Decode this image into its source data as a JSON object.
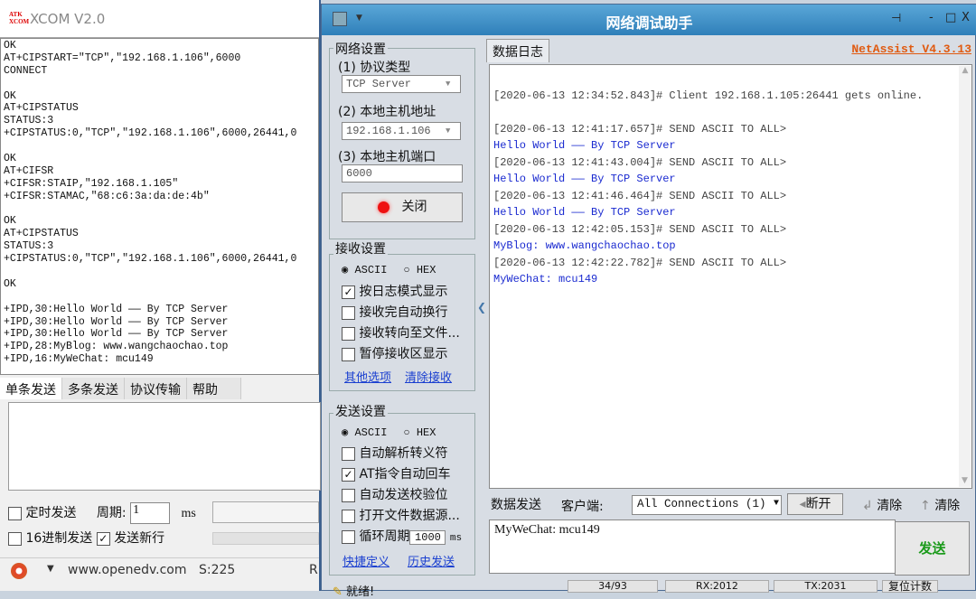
{
  "xcom": {
    "title": "XCOM V2.0",
    "logo_text": "ATK XCOM",
    "receive_lines": [
      "OK",
      "AT+CIPSTART=\"TCP\",\"192.168.1.106\",6000",
      "CONNECT",
      "",
      "OK",
      "AT+CIPSTATUS",
      "STATUS:3",
      "+CIPSTATUS:0,\"TCP\",\"192.168.1.106\",6000,26441,0",
      "",
      "OK",
      "AT+CIFSR",
      "+CIFSR:STAIP,\"192.168.1.105\"",
      "+CIFSR:STAMAC,\"68:c6:3a:da:de:4b\"",
      "",
      "OK",
      "AT+CIPSTATUS",
      "STATUS:3",
      "+CIPSTATUS:0,\"TCP\",\"192.168.1.106\",6000,26441,0",
      "",
      "OK",
      "",
      "+IPD,30:Hello World —— By TCP Server",
      "+IPD,30:Hello World —— By TCP Server",
      "+IPD,30:Hello World —— By TCP Server",
      "+IPD,28:MyBlog: www.wangchaochao.top",
      "+IPD,16:MyWeChat: mcu149"
    ],
    "tabs": [
      "单条发送",
      "多条发送",
      "协议传输",
      "帮助"
    ],
    "timed_send": "定时发送",
    "period_label": "周期:",
    "period_value": "1",
    "period_unit": "ms",
    "hex_send": "16进制发送",
    "send_newline": "发送新行",
    "status_url": "www.openedv.com",
    "status_s": "S:225",
    "status_r": "R"
  },
  "netassist": {
    "title": "网络调试助手",
    "version": "NetAssist V4.3.13",
    "net_settings": "网络设置",
    "protocol_label": "(1) 协议类型",
    "protocol_value": "TCP Server",
    "host_label": "(2) 本地主机地址",
    "host_value": "192.168.1.106",
    "port_label": "(3) 本地主机端口",
    "port_value": "6000",
    "close_button": "关闭",
    "recv_settings": "接收设置",
    "ascii": "ASCII",
    "hex": "HEX",
    "recv_opts": [
      {
        "label": "按日志模式显示",
        "checked": true
      },
      {
        "label": "接收完自动换行",
        "checked": false
      },
      {
        "label": "接收转向至文件...",
        "checked": false
      },
      {
        "label": "暂停接收区显示",
        "checked": false
      }
    ],
    "more_options": "其他选项",
    "clear_recv": "清除接收",
    "send_settings": "发送设置",
    "send_opts": [
      {
        "label": "自动解析转义符",
        "checked": false
      },
      {
        "label": "AT指令自动回车",
        "checked": true
      },
      {
        "label": "自动发送校验位",
        "checked": false
      },
      {
        "label": "打开文件数据源...",
        "checked": false
      }
    ],
    "loop_label": "循环周期",
    "loop_value": "1000",
    "loop_unit": "ms",
    "shortcut": "快捷定义",
    "history": "历史发送",
    "log_tab": "数据日志",
    "log": [
      {
        "t": "",
        "c": "sys"
      },
      {
        "t": "[2020-06-13 12:34:52.843]# Client 192.168.1.105:26441 gets online.",
        "c": "sys"
      },
      {
        "t": "",
        "c": "sys"
      },
      {
        "t": "[2020-06-13 12:41:17.657]# SEND ASCII TO ALL>",
        "c": "sys"
      },
      {
        "t": "Hello World —— By TCP Server",
        "c": "msg"
      },
      {
        "t": "[2020-06-13 12:41:43.004]# SEND ASCII TO ALL>",
        "c": "sys"
      },
      {
        "t": "Hello World —— By TCP Server",
        "c": "msg"
      },
      {
        "t": "[2020-06-13 12:41:46.464]# SEND ASCII TO ALL>",
        "c": "sys"
      },
      {
        "t": "Hello World —— By TCP Server",
        "c": "msg"
      },
      {
        "t": "[2020-06-13 12:42:05.153]# SEND ASCII TO ALL>",
        "c": "sys"
      },
      {
        "t": "MyBlog: www.wangchaochao.top",
        "c": "msg"
      },
      {
        "t": "[2020-06-13 12:42:22.782]# SEND ASCII TO ALL>",
        "c": "sys"
      },
      {
        "t": "MyWeChat: mcu149",
        "c": "msg"
      }
    ],
    "send_tab": "数据发送",
    "client_label": "客户端:",
    "client_value": "All Connections (1)",
    "disconnect": "断开",
    "clear1": "清除",
    "clear2": "清除",
    "send_text": "MyWeChat: mcu149",
    "send_button": "发送",
    "status_ready": "就绪!",
    "count": "34/93",
    "rx": "RX:2012",
    "tx": "TX:2031",
    "reset": "复位计数"
  }
}
